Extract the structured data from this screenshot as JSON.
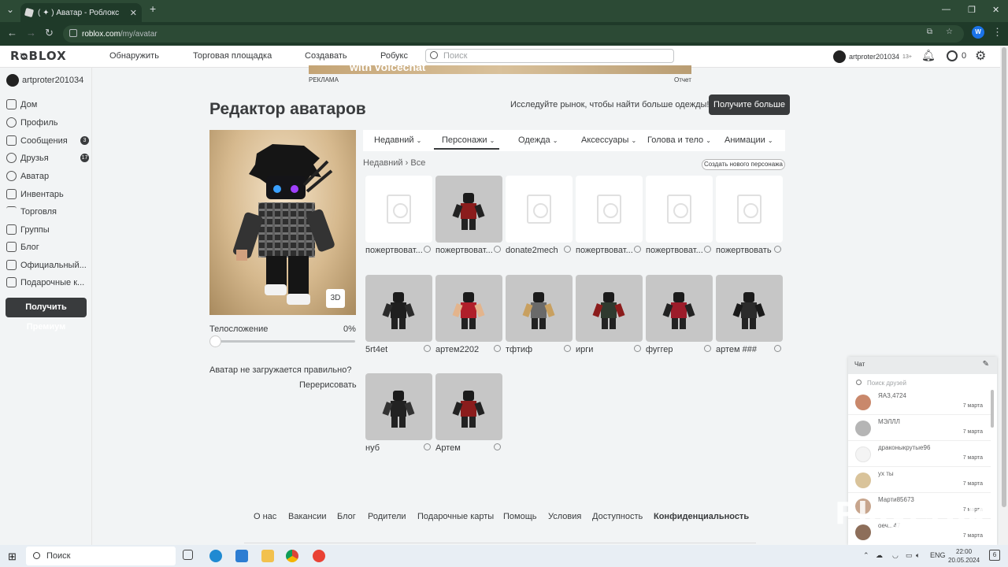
{
  "browser": {
    "tab_title": "( ✦ ) Аватар - Роблокс",
    "url_domain": "roblox.com",
    "url_path": "/my/avatar",
    "profile_letter": "W"
  },
  "topnav": {
    "logo": "RᴓBLOX",
    "links": [
      "Обнаружить",
      "Торговая площадка",
      "Создавать",
      "Робукс"
    ],
    "search_placeholder": "Поиск",
    "username": "artproter201034",
    "age": "13+",
    "robux": "0"
  },
  "sidebar": {
    "username": "artproter201034",
    "items": [
      {
        "label": "Дом",
        "icon": "home-icon",
        "badge": ""
      },
      {
        "label": "Профиль",
        "icon": "profile-icon",
        "badge": ""
      },
      {
        "label": "Сообщения",
        "icon": "messages-icon",
        "badge": "3"
      },
      {
        "label": "Друзья",
        "icon": "friends-icon",
        "badge": "17"
      },
      {
        "label": "Аватар",
        "icon": "avatar-icon",
        "badge": ""
      },
      {
        "label": "Инвентарь",
        "icon": "inventory-icon",
        "badge": ""
      },
      {
        "label": "Торговля",
        "icon": "trade-icon",
        "badge": ""
      },
      {
        "label": "Группы",
        "icon": "groups-icon",
        "badge": ""
      },
      {
        "label": "Блог",
        "icon": "blog-icon",
        "badge": ""
      },
      {
        "label": "Официальный...",
        "icon": "store-icon",
        "badge": ""
      },
      {
        "label": "Подарочные к...",
        "icon": "gift-card-icon",
        "badge": ""
      }
    ],
    "premium_button": "Получить Премиум"
  },
  "ad": {
    "text": "with voicechat",
    "label": "РЕКЛАМА",
    "report": "Отчет"
  },
  "editor": {
    "title": "Редактор аватаров",
    "explore_text": "Исследуйте рынок, чтобы найти больше одежды!",
    "get_more": "Получите больше",
    "btn_3d": "3D",
    "body_label": "Телосложение",
    "body_value": "0%",
    "not_loading": "Аватар не загружается правильно?",
    "redraw": "Перерисовать",
    "categories": [
      "Недавний",
      "Персонажи",
      "Одежда",
      "Аксессуары",
      "Голова и тело",
      "Анимации"
    ],
    "active_category": "Персонажи",
    "breadcrumb_a": "Недавний",
    "breadcrumb_b": "Все",
    "create_new": "Создать нового персонажа",
    "characters": [
      {
        "name": "пожертвоват...",
        "blank": true
      },
      {
        "name": "пожертвоват...",
        "blank": false
      },
      {
        "name": "donate2mech",
        "blank": true
      },
      {
        "name": "пожертвоват...",
        "blank": true
      },
      {
        "name": "пожертвоват...",
        "blank": true
      },
      {
        "name": "пожертвовать",
        "blank": true
      },
      {
        "name": "5rt4et",
        "blank": false
      },
      {
        "name": "артем2202",
        "blank": false
      },
      {
        "name": "тфтиф",
        "blank": false
      },
      {
        "name": "ирги",
        "blank": false
      },
      {
        "name": "фуггер",
        "blank": false
      },
      {
        "name": "артем ###",
        "blank": false
      },
      {
        "name": "нуб",
        "blank": false
      },
      {
        "name": "Артем",
        "blank": false
      }
    ]
  },
  "footer": {
    "links": [
      "О нас",
      "Вакансии",
      "Блог",
      "Родители",
      "Подарочные карты",
      "Помощь",
      "Условия",
      "Доступность",
      "Конфиденциальность"
    ]
  },
  "chat": {
    "title": "Чат",
    "search_placeholder": "Поиск друзей",
    "entries": [
      {
        "name": "ЯАЗ,4724",
        "date": "7 марта"
      },
      {
        "name": "МЭЛЛЛ",
        "date": "7 марта"
      },
      {
        "name": "драконыкрутые96",
        "date": "7 марта"
      },
      {
        "name": "ух ты",
        "date": "7 марта"
      },
      {
        "name": "Марти85673",
        "date": "7 марта"
      },
      {
        "name": "оеч...47",
        "date": "7 марта"
      }
    ]
  },
  "watermark": "Playerok",
  "taskbar": {
    "search": "Поиск",
    "lang": "ENG",
    "time": "22:00",
    "date": "20.05.2024"
  }
}
